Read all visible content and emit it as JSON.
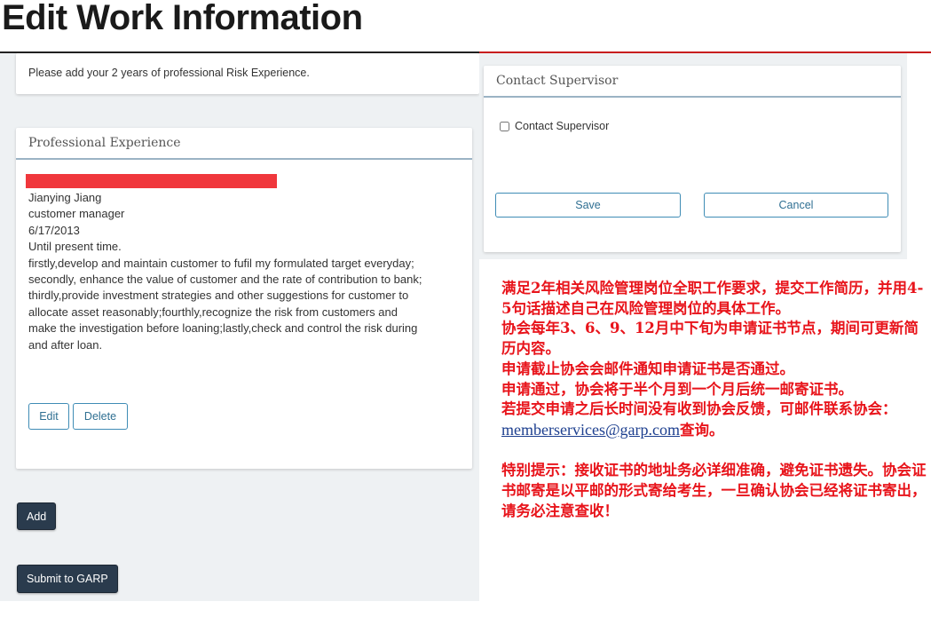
{
  "page_title": "Edit Work Information",
  "info_card": {
    "text": "Please add your 2 years of professional Risk Experience."
  },
  "experience_card": {
    "title": "Professional Experience",
    "lines": [
      "Jianying Jiang",
      "customer manager",
      "6/17/2013",
      "Until present time.",
      "firstly,develop and maintain customer to fufil my formulated target everyday;",
      "secondly, enhance the value of customer and the rate of contribution to bank;",
      "thirdly,provide investment strategies and other suggestions for customer to",
      "allocate asset reasonably;fourthly,recognize the risk from customers and",
      "make the investigation before loaning;lastly,check and control the risk during",
      "and after loan."
    ],
    "edit_label": "Edit",
    "delete_label": "Delete"
  },
  "add_label": "Add",
  "submit_label": "Submit to GARP",
  "supervisor_card": {
    "title": "Contact Supervisor",
    "checkbox_label": "Contact Supervisor",
    "checkbox_checked": false,
    "save_label": "Save",
    "cancel_label": "Cancel"
  },
  "note": {
    "p1": "满足2年相关风险管理岗位全职工作要求，提交工作简历，并用4-5句话描述自己在风险管理岗位的具体工作。",
    "p2": "协会每年3、6、9、12月中下旬为申请证书节点，期间可更新简历内容。",
    "p3": "申请截止协会会邮件通知申请证书是否通过。",
    "p4": "申请通过，协会将于半个月到一个月后统一邮寄证书。",
    "p5_before": "若提交申请之后长时间没有收到协会反馈，可邮件联系协会：",
    "p5_email": "memberservices@garp.com",
    "p5_after": "查询。",
    "p6": "特别提示：接收证书的地址务必详细准确，避免证书遗失。协会证书邮寄是以平邮的形式寄给考生，一旦确认协会已经将证书寄出，请务必注意查收！"
  },
  "colors": {
    "note_red": "#e8141b",
    "button_dark": "#2a3b4d",
    "button_outline": "#3f8cb5",
    "email_blue": "#1d3f8f"
  }
}
